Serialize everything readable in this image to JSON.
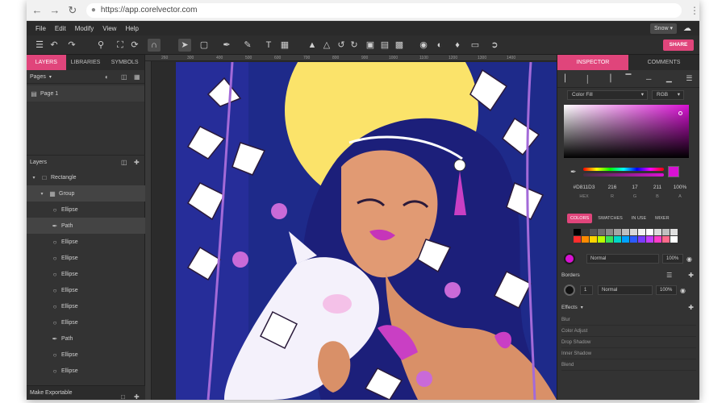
{
  "browser": {
    "url": "https://app.corelvector.com",
    "back_icon": "arrow-left-icon",
    "forward_icon": "arrow-right-icon",
    "reload_icon": "reload-icon",
    "menu_icon": "more-vertical-icon"
  },
  "menubar": {
    "items": [
      "File",
      "Edit",
      "Modify",
      "View",
      "Help"
    ],
    "user_menu": "Snow",
    "cloud_icon": "cloud-sync-icon"
  },
  "toolbar": {
    "share_label": "SHARE",
    "accent_color": "#e0457b"
  },
  "left_panel": {
    "tabs": [
      "LAYERS",
      "LIBRARIES",
      "SYMBOLS"
    ],
    "active_tab": "LAYERS",
    "pages_label": "Pages",
    "pages": [
      "Page 1"
    ],
    "layers_label": "Layers",
    "layers": [
      {
        "name": "Rectangle",
        "icon": "square-icon"
      },
      {
        "name": "Group",
        "icon": "folder-icon"
      },
      {
        "name": "Ellipse",
        "icon": "circle-icon"
      },
      {
        "name": "Path",
        "icon": "pen-icon"
      },
      {
        "name": "Ellipse",
        "icon": "circle-icon"
      },
      {
        "name": "Ellipse",
        "icon": "circle-icon"
      },
      {
        "name": "Ellipse",
        "icon": "circle-icon"
      },
      {
        "name": "Ellipse",
        "icon": "circle-icon"
      },
      {
        "name": "Ellipse",
        "icon": "circle-icon"
      },
      {
        "name": "Ellipse",
        "icon": "circle-icon"
      },
      {
        "name": "Path",
        "icon": "pen-icon"
      },
      {
        "name": "Ellipse",
        "icon": "circle-icon"
      },
      {
        "name": "Ellipse",
        "icon": "circle-icon"
      }
    ],
    "footer": "Make Exportable"
  },
  "ruler": {
    "labels": [
      "260",
      "300",
      "400",
      "500",
      "600",
      "700",
      "800",
      "900",
      "1000",
      "1100",
      "1200",
      "1300",
      "1400"
    ]
  },
  "right_panel": {
    "tabs": [
      "INSPECTOR",
      "COMMENTS"
    ],
    "active_tab": "INSPECTOR",
    "fill_mode": "Color Fill",
    "color_model": "RGB",
    "color": {
      "hex": "#D811D3",
      "r": "216",
      "g": "17",
      "b": "211",
      "a": "100%",
      "swatch": "#d811d3"
    },
    "color_labels": [
      "HEX",
      "R",
      "G",
      "B",
      "A"
    ],
    "color_tabs": [
      "COLORS",
      "SWATCHES",
      "IN USE",
      "MIXER"
    ],
    "palette": [
      "#000000",
      "#3a3a3a",
      "#555555",
      "#6f6f6f",
      "#8a8a8a",
      "#a5a5a5",
      "#bfbfbf",
      "#d9d9d9",
      "#f2f2f2",
      "#ffffff",
      "#dcdcdc",
      "#c0c0c0",
      "#e0e0e0",
      "#ff2d2d",
      "#ff8a00",
      "#ffd400",
      "#b8ff00",
      "#38e05a",
      "#00d6c8",
      "#00a2ff",
      "#2c5bff",
      "#7a3cff",
      "#c43cff",
      "#ff3cc8",
      "#ff6a8a",
      "#ffffff"
    ],
    "fill_blend": "Normal",
    "fill_opacity": "100%",
    "borders_label": "Borders",
    "border_width": "1",
    "border_blend": "Normal",
    "border_opacity": "100%",
    "effects_label": "Effects",
    "effects": [
      "Blur",
      "Color Adjust",
      "Drop Shadow",
      "Inner Shadow",
      "Blend"
    ]
  }
}
